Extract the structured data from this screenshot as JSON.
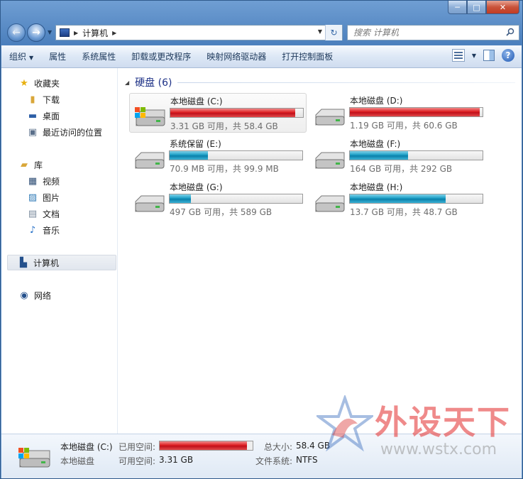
{
  "window": {
    "min": "─",
    "max": "□",
    "close": "✕"
  },
  "address": {
    "crumb": "计算机",
    "search_placeholder": "搜索 计算机"
  },
  "toolbar": {
    "organize": "组织",
    "items": [
      "属性",
      "系统属性",
      "卸载或更改程序",
      "映射网络驱动器",
      "打开控制面板"
    ]
  },
  "sidebar": {
    "favorites": "收藏夹",
    "fav_items": [
      "下载",
      "桌面",
      "最近访问的位置"
    ],
    "libraries": "库",
    "lib_items": [
      "视频",
      "图片",
      "文档",
      "音乐"
    ],
    "computer": "计算机",
    "network": "网络"
  },
  "group": {
    "title": "硬盘 (6)"
  },
  "drives": [
    {
      "name": "本地磁盘 (C:)",
      "size": "3.31 GB 可用，共 58.4 GB",
      "used_fraction": 0.94,
      "color": "red"
    },
    {
      "name": "本地磁盘 (D:)",
      "size": "1.19 GB 可用，共 60.6 GB",
      "used_fraction": 0.98,
      "color": "red"
    },
    {
      "name": "系统保留 (E:)",
      "size": "70.9 MB 可用，共 99.9 MB",
      "used_fraction": 0.29,
      "color": "blue"
    },
    {
      "name": "本地磁盘 (F:)",
      "size": "164 GB 可用，共 292 GB",
      "used_fraction": 0.44,
      "color": "blue"
    },
    {
      "name": "本地磁盘 (G:)",
      "size": "497 GB 可用，共 589 GB",
      "used_fraction": 0.16,
      "color": "blue"
    },
    {
      "name": "本地磁盘 (H:)",
      "size": "13.7 GB 可用，共 48.7 GB",
      "used_fraction": 0.72,
      "color": "blue"
    }
  ],
  "status": {
    "name": "本地磁盘 (C:)",
    "type": "本地磁盘",
    "used_label": "已用空间:",
    "free_label": "可用空间:",
    "free_value": "3.31 GB",
    "total_label": "总大小:",
    "total_value": "58.4 GB",
    "fs_label": "文件系统:",
    "fs_value": "NTFS",
    "used_fraction": 0.94
  },
  "watermark": {
    "text": "外设天下",
    "url": "www.wstx.com"
  },
  "colors": {
    "red_bar": "#de1f22",
    "blue_bar": "#1a9dc4",
    "title_blue": "#1e3287"
  }
}
